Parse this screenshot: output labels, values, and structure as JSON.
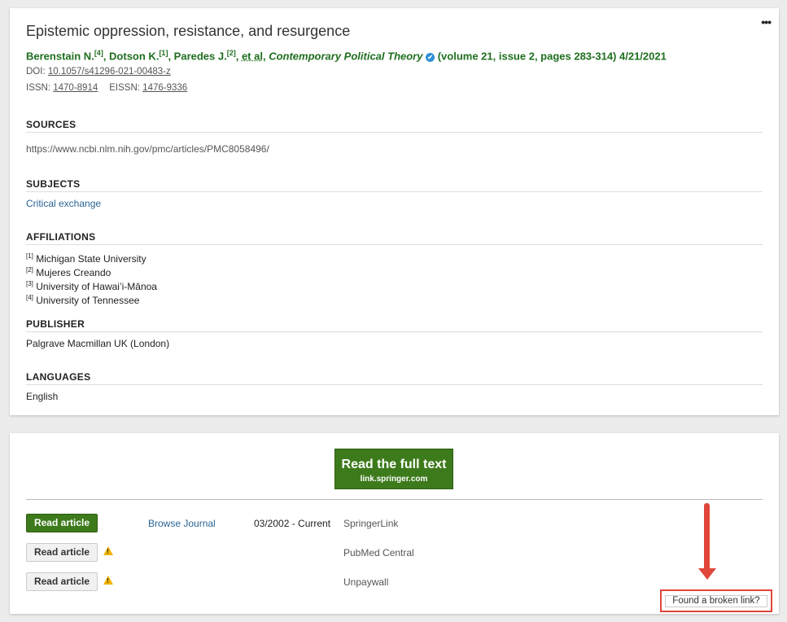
{
  "article": {
    "title": "Epistemic oppression, resistance, and resurgence",
    "more_label": "•••",
    "authors": [
      {
        "name": "Berenstain N.",
        "ref": "[4]"
      },
      {
        "name": "Dotson K.",
        "ref": "[1]"
      },
      {
        "name": "Paredes J.",
        "ref": "[2]"
      }
    ],
    "et_al": "et al",
    "journal": "Contemporary Political Theory",
    "verified_icon": "✔",
    "volume_info": "(volume 21, issue 2, pages 283-314) 4/21/2021",
    "doi_label": "DOI:",
    "doi": "10.1057/s41296-021-00483-z",
    "issn_label": "ISSN:",
    "issn": "1470-8914",
    "eissn_label": "EISSN:",
    "eissn": "1476-9336"
  },
  "sections": {
    "sources_title": "SOURCES",
    "sources_url": "https://www.ncbi.nlm.nih.gov/pmc/articles/PMC8058496/",
    "subjects_title": "SUBJECTS",
    "subjects_item": "Critical exchange",
    "affiliations_title": "AFFILIATIONS",
    "affiliations": [
      {
        "ref": "[1]",
        "name": "Michigan State University"
      },
      {
        "ref": "[2]",
        "name": "Mujeres Creando"
      },
      {
        "ref": "[3]",
        "name": "University of Hawai’i-Mānoa"
      },
      {
        "ref": "[4]",
        "name": "University of Tennessee"
      }
    ],
    "publisher_title": "PUBLISHER",
    "publisher": "Palgrave Macmillan UK (London)",
    "languages_title": "LANGUAGES",
    "language": "English"
  },
  "fulltext": {
    "label": "Read the full text",
    "host": "link.springer.com"
  },
  "access_rows": [
    {
      "button": "Read article",
      "browse": "Browse Journal",
      "range": "03/2002 - Current",
      "provider": "SpringerLink"
    },
    {
      "button": "Read article",
      "warning": "!",
      "provider": "PubMed Central"
    },
    {
      "button": "Read article",
      "warning": "!",
      "provider": "Unpaywall"
    }
  ],
  "broken_link": "Found a broken link?",
  "colors": {
    "accent_green": "#3d7a1b",
    "link_blue": "#2a6496",
    "highlight_red": "#e0463a"
  }
}
